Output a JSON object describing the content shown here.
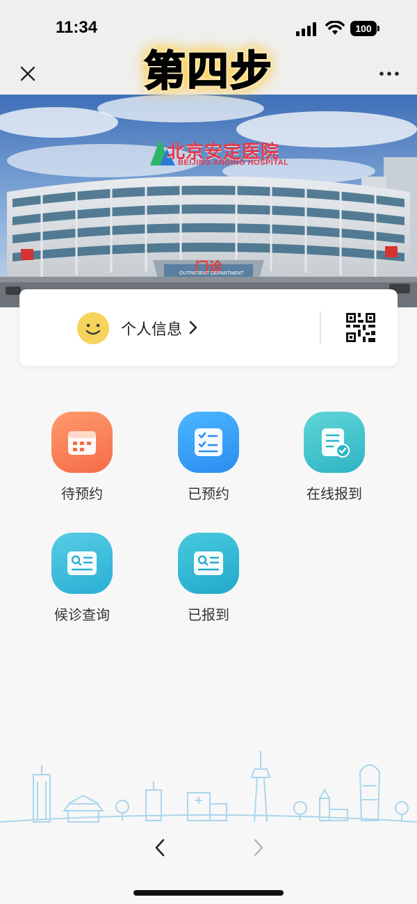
{
  "status_bar": {
    "time": "11:34",
    "battery": "100",
    "icons": [
      "signal-icon",
      "wifi-icon",
      "battery-icon"
    ]
  },
  "nav": {
    "title_overlay": "第四步",
    "close_icon": "close-icon",
    "more_icon": "more-icon"
  },
  "banner": {
    "hospital_name_cn": "北京安定医院",
    "hospital_name_en": "BEIJING ANDING HOSPITAL",
    "door_sign": "门诊",
    "door_sign_en": "OUTPATIENT DEPARTMENT"
  },
  "info_card": {
    "label": "个人信息",
    "icons": [
      "smiley-avatar-icon",
      "chevron-right-icon",
      "qr-code-icon"
    ]
  },
  "menu": {
    "items": [
      {
        "label": "待预约",
        "icon": "calendar-icon",
        "color": "#f46c4a"
      },
      {
        "label": "已预约",
        "icon": "checklist-icon",
        "color": "#2a8cf0"
      },
      {
        "label": "在线报到",
        "icon": "document-check-icon",
        "color": "#2fb4c4"
      },
      {
        "label": "候诊查询",
        "icon": "id-card-icon",
        "color": "#2aaed3"
      },
      {
        "label": "已报到",
        "icon": "id-card-icon",
        "color": "#22a9c9"
      }
    ]
  },
  "bottom_nav": {
    "icons": [
      "back-arrow-icon",
      "forward-arrow-icon"
    ]
  }
}
